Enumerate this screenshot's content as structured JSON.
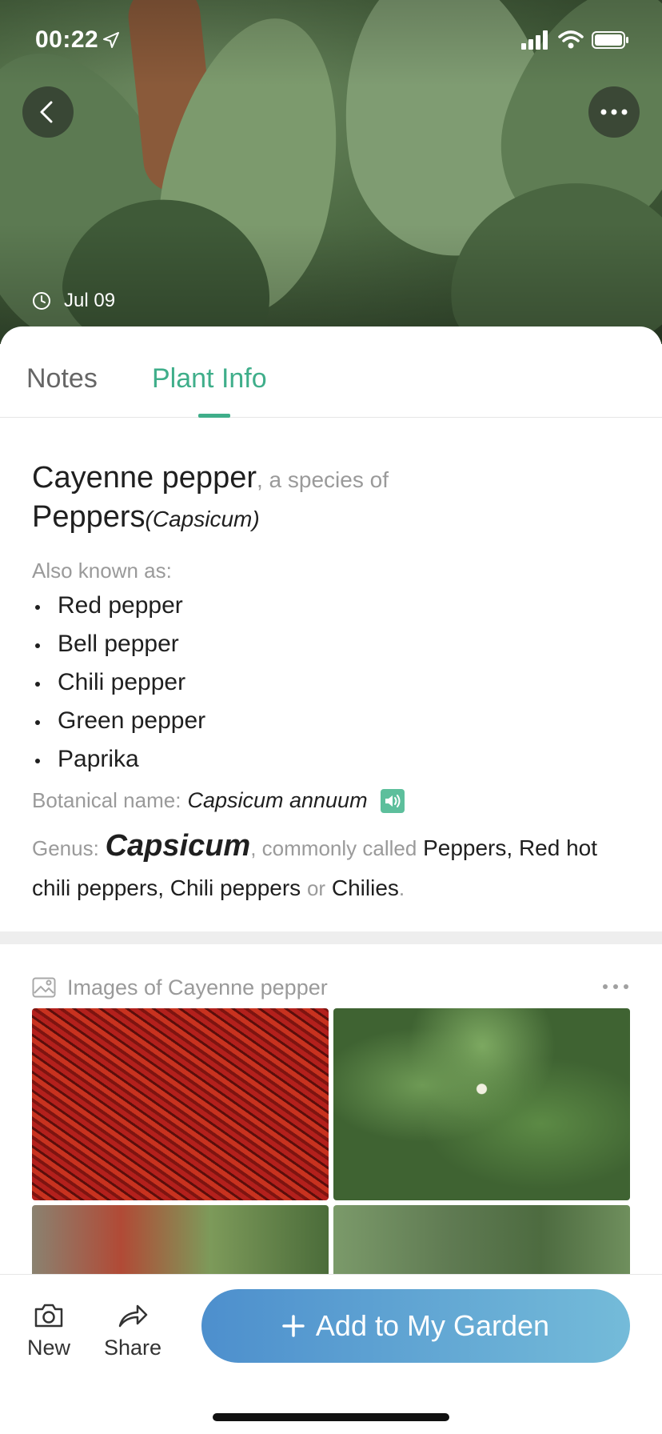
{
  "status_bar": {
    "time": "00:22"
  },
  "hero": {
    "date": "Jul 09"
  },
  "tabs": [
    {
      "label": "Notes",
      "active": false
    },
    {
      "label": "Plant Info",
      "active": true
    }
  ],
  "info": {
    "common_name": "Cayenne pepper",
    "species_of_text": ", a species of",
    "genus_common": "Peppers",
    "genus_sci": "(Capsicum)",
    "aka_label": "Also known as:",
    "aka": [
      "Red pepper",
      "Bell pepper",
      "Chili pepper",
      "Green pepper",
      "Paprika"
    ],
    "botanical_label": "Botanical name:",
    "botanical_name": "Capsicum annuum",
    "genus_label": "Genus:",
    "genus_name": "Capsicum",
    "commonly_called_text": ", commonly called",
    "common_names_a": "Peppers, Red hot chili peppers, Chili peppers",
    "or_text": "or",
    "common_names_b": "Chilies",
    "period": "."
  },
  "images_section": {
    "title": "Images of Cayenne pepper"
  },
  "bottom_bar": {
    "new_label": "New",
    "share_label": "Share",
    "add_label": "Add to My Garden"
  },
  "colors": {
    "accent_green": "#3fae8a",
    "button_gradient_start": "#4d8fcd",
    "button_gradient_end": "#74bbd9"
  }
}
